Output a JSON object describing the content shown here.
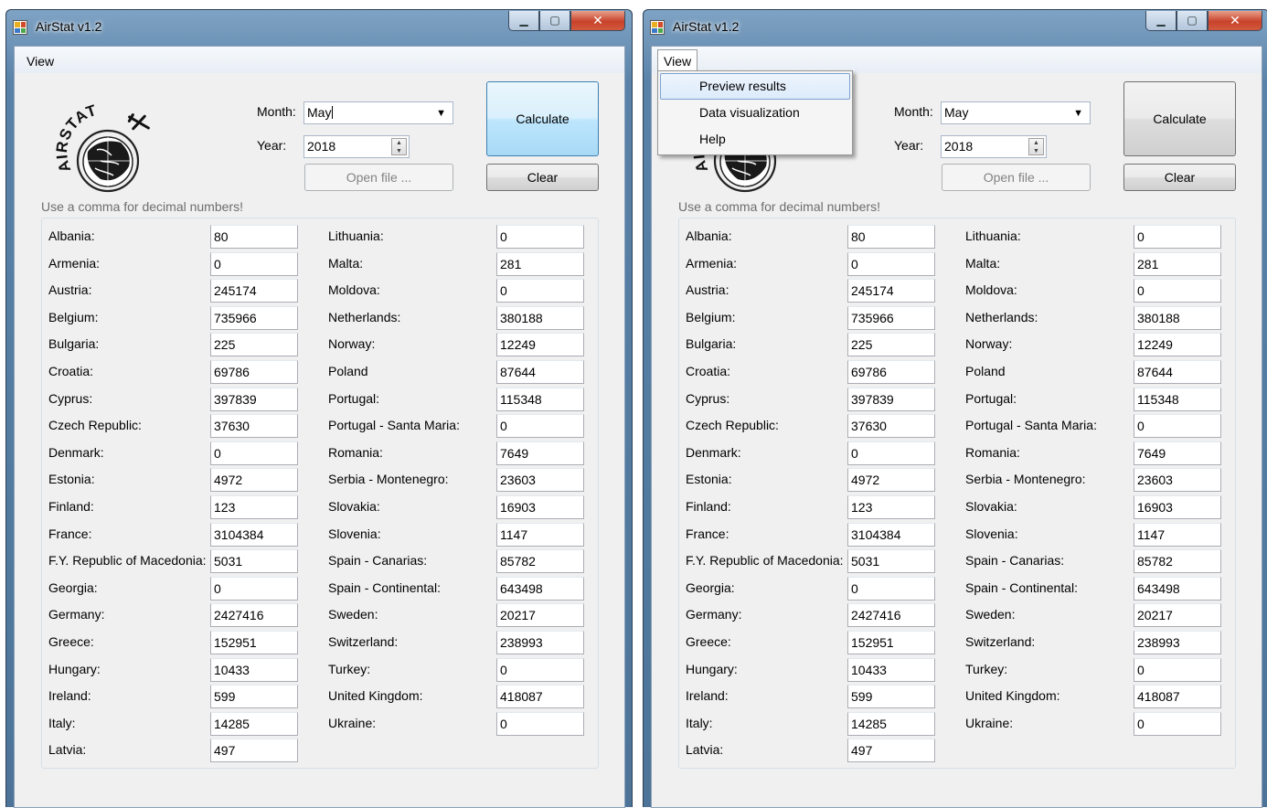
{
  "window_title": "AirStat v1.2",
  "menu": {
    "view": "View",
    "dropdown_items": [
      "Preview results",
      "Data visualization",
      "Help"
    ]
  },
  "logo_text": "AIRSTAT",
  "form": {
    "month_label": "Month:",
    "month_value": "May",
    "year_label": "Year:",
    "year_value": "2018",
    "open_file_label": "Open file ...",
    "calculate_label": "Calculate",
    "clear_label": "Clear",
    "hint": "Use a comma for decimal numbers!"
  },
  "countries_left": [
    {
      "name": "Albania:",
      "value": "80"
    },
    {
      "name": "Armenia:",
      "value": "0"
    },
    {
      "name": "Austria:",
      "value": "245174"
    },
    {
      "name": "Belgium:",
      "value": "735966"
    },
    {
      "name": "Bulgaria:",
      "value": "225"
    },
    {
      "name": "Croatia:",
      "value": "69786"
    },
    {
      "name": "Cyprus:",
      "value": "397839"
    },
    {
      "name": "Czech Republic:",
      "value": "37630"
    },
    {
      "name": "Denmark:",
      "value": "0"
    },
    {
      "name": "Estonia:",
      "value": "4972"
    },
    {
      "name": "Finland:",
      "value": "123"
    },
    {
      "name": "France:",
      "value": "3104384"
    },
    {
      "name": "F.Y. Republic of Macedonia:",
      "value": "5031"
    },
    {
      "name": "Georgia:",
      "value": "0"
    },
    {
      "name": "Germany:",
      "value": "2427416"
    },
    {
      "name": "Greece:",
      "value": "152951"
    },
    {
      "name": "Hungary:",
      "value": "10433"
    },
    {
      "name": "Ireland:",
      "value": "599"
    },
    {
      "name": "Italy:",
      "value": "14285"
    },
    {
      "name": "Latvia:",
      "value": "497"
    }
  ],
  "countries_right": [
    {
      "name": "Lithuania:",
      "value": "0"
    },
    {
      "name": "Malta:",
      "value": "281"
    },
    {
      "name": "Moldova:",
      "value": "0"
    },
    {
      "name": "Netherlands:",
      "value": "380188"
    },
    {
      "name": "Norway:",
      "value": "12249"
    },
    {
      "name": "Poland",
      "value": "87644"
    },
    {
      "name": "Portugal:",
      "value": "115348"
    },
    {
      "name": "Portugal - Santa Maria:",
      "value": "0"
    },
    {
      "name": "Romania:",
      "value": "7649"
    },
    {
      "name": "Serbia - Montenegro:",
      "value": "23603"
    },
    {
      "name": "Slovakia:",
      "value": "16903"
    },
    {
      "name": "Slovenia:",
      "value": "1147"
    },
    {
      "name": "Spain - Canarias:",
      "value": "85782"
    },
    {
      "name": "Spain - Continental:",
      "value": "643498"
    },
    {
      "name": "Sweden:",
      "value": "20217"
    },
    {
      "name": "Switzerland:",
      "value": "238993"
    },
    {
      "name": "Turkey:",
      "value": "0"
    },
    {
      "name": "United Kingdom:",
      "value": "418087"
    },
    {
      "name": "Ukraine:",
      "value": "0"
    }
  ],
  "colors": {
    "window_frame": "#5a82a8",
    "client_background": "#f0f0f0",
    "close_button": "#c8422a",
    "menu_highlight": "#dcebfb",
    "focused_button": "#bee6fd"
  }
}
